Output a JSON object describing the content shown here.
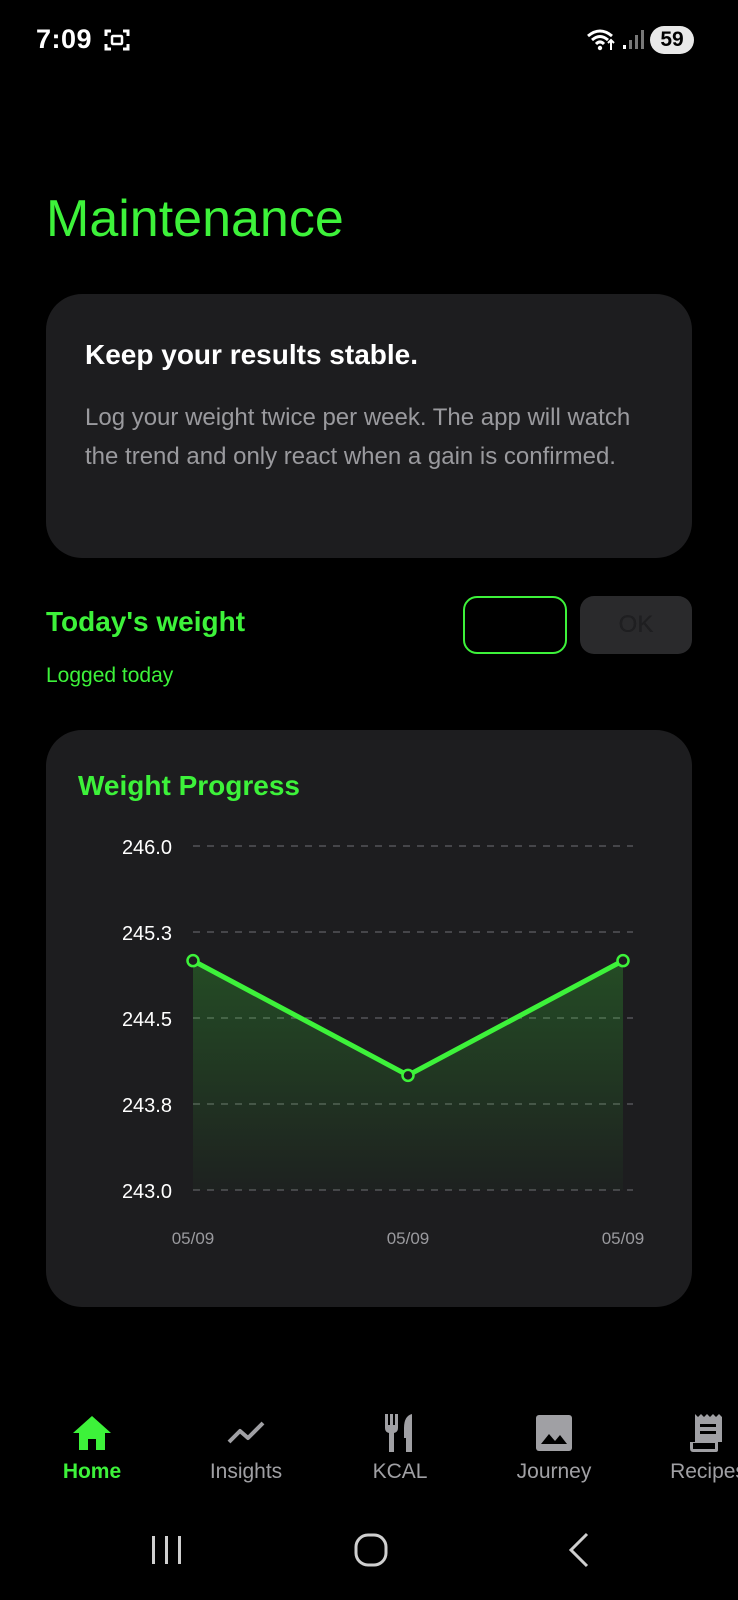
{
  "status_bar": {
    "time": "7:09",
    "battery": "59",
    "icons": [
      "screenshot-icon",
      "wifi-icon",
      "signal-icon"
    ]
  },
  "page": {
    "title": "Maintenance"
  },
  "info_card": {
    "title": "Keep your results stable.",
    "body": "Log your weight twice per week. The app will watch the trend and only react when a gain is confirmed."
  },
  "weight_entry": {
    "label": "Today's weight",
    "status": "Logged today",
    "input_value": "",
    "input_placeholder": "",
    "ok_label": "OK"
  },
  "chart_data": {
    "type": "area",
    "title": "Weight Progress",
    "categories": [
      "05/09",
      "05/09",
      "05/09"
    ],
    "values": [
      245.0,
      244.0,
      245.0
    ],
    "ylim": [
      243.0,
      246.0
    ],
    "y_ticks": [
      "246.0",
      "245.3",
      "244.5",
      "243.8",
      "243.0"
    ],
    "y_tick_values": [
      246.0,
      245.25,
      244.5,
      243.75,
      243.0
    ],
    "grid": true,
    "line_color": "#3df23a",
    "marker_fill": "#1d1d1f"
  },
  "bottom_nav": {
    "items": [
      {
        "label": "Home",
        "icon": "home-icon",
        "active": true
      },
      {
        "label": "Insights",
        "icon": "trending-icon",
        "active": false
      },
      {
        "label": "KCAL",
        "icon": "restaurant-icon",
        "active": false
      },
      {
        "label": "Journey",
        "icon": "image-icon",
        "active": false
      },
      {
        "label": "Recipes",
        "icon": "receipt-icon",
        "active": false
      }
    ]
  },
  "colors": {
    "accent": "#3df23a",
    "card_bg": "#1d1d1f",
    "background": "#000000",
    "muted_text": "#9a9a9e"
  }
}
